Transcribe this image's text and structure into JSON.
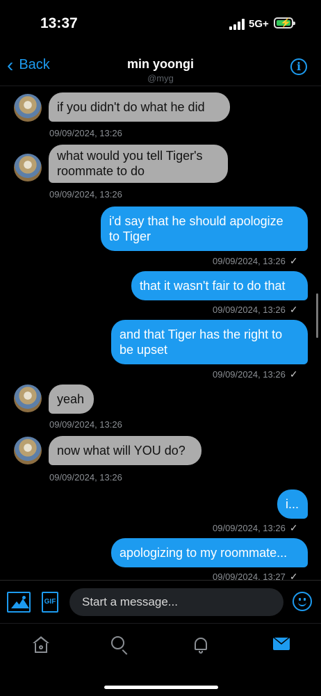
{
  "status_bar": {
    "time": "13:37",
    "network": "5G+"
  },
  "header": {
    "back_label": "Back",
    "title": "min yoongi",
    "handle": "@myg",
    "info_icon": "i"
  },
  "messages": [
    {
      "side": "in",
      "text": "if you didn't do what he did",
      "timestamp": "09/09/2024, 13:26"
    },
    {
      "side": "in",
      "text": "what would you tell Tiger's\nroommate to do",
      "timestamp": "09/09/2024, 13:26"
    },
    {
      "side": "out",
      "text": "i'd say that he should apologize\nto Tiger",
      "timestamp": "09/09/2024, 13:26"
    },
    {
      "side": "out",
      "text": "that it wasn't fair to do that",
      "timestamp": "09/09/2024, 13:26"
    },
    {
      "side": "out",
      "text": "and that Tiger has the right to\nbe upset",
      "timestamp": "09/09/2024, 13:26"
    },
    {
      "side": "in",
      "text": "yeah",
      "timestamp": "09/09/2024, 13:26"
    },
    {
      "side": "in",
      "text": "now what will YOU do?",
      "timestamp": "09/09/2024, 13:26"
    },
    {
      "side": "out",
      "text": "i...",
      "timestamp": "09/09/2024, 13:26"
    },
    {
      "side": "out",
      "text": "apologizing to my roommate...",
      "timestamp": "09/09/2024, 13:27"
    }
  ],
  "composer": {
    "placeholder": "Start a message...",
    "gif_label": "GIF"
  },
  "colors": {
    "accent": "#1d9bf0",
    "incoming_bubble": "#acacac",
    "background": "#000000"
  }
}
